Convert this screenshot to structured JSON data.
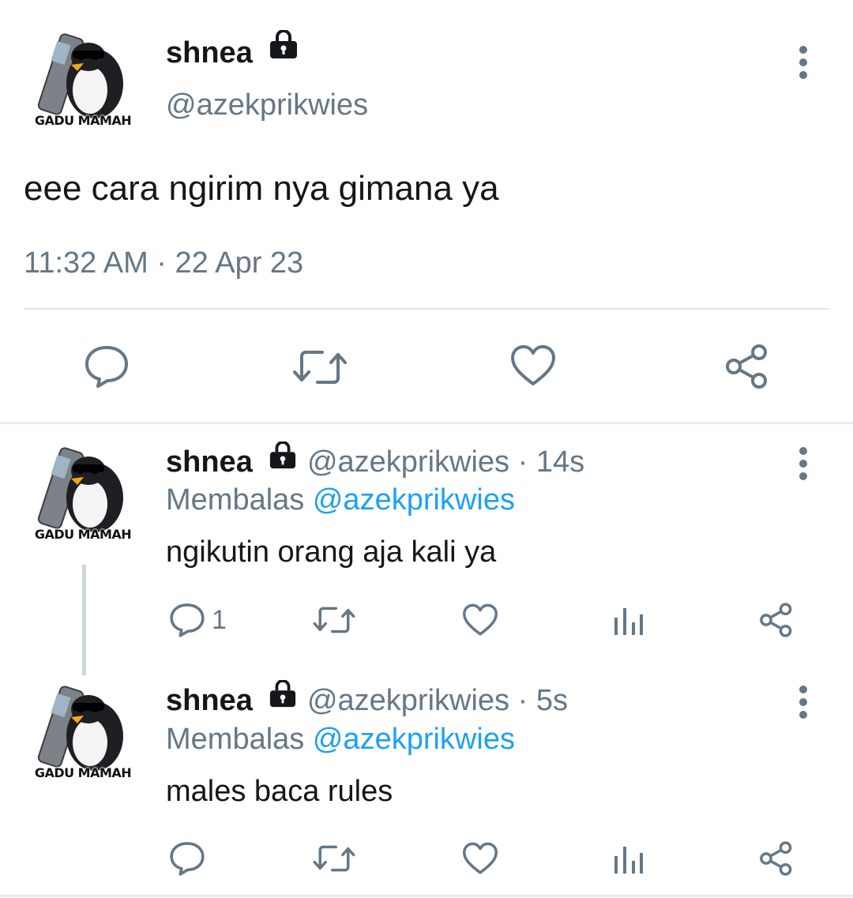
{
  "main_tweet": {
    "display_name": "shnea",
    "handle": "@azekprikwies",
    "text": "eee cara ngirim nya gimana ya",
    "timestamp": "11:32 AM · 22 Apr 23",
    "avatar_caption": "GADU MAMAH",
    "actions": [
      "reply-icon",
      "retweet-icon",
      "like-icon",
      "share-icon"
    ]
  },
  "replies": [
    {
      "display_name": "shnea",
      "handle_meta": "@azekprikwies · 14s",
      "replying_label": "Membalas",
      "replying_to": "@azekprikwies",
      "text": "ngikutin orang aja kali ya",
      "reply_count": "1",
      "avatar_caption": "GADU MAMAH"
    },
    {
      "display_name": "shnea",
      "handle_meta": "@azekprikwies · 5s",
      "replying_label": "Membalas",
      "replying_to": "@azekprikwies",
      "text": "males baca rules",
      "reply_count": "",
      "avatar_caption": "GADU MAMAH"
    }
  ],
  "colors": {
    "text": "#14171a",
    "secondary": "#657786",
    "accent": "#1da1f2",
    "divider": "#e1e8ed"
  }
}
